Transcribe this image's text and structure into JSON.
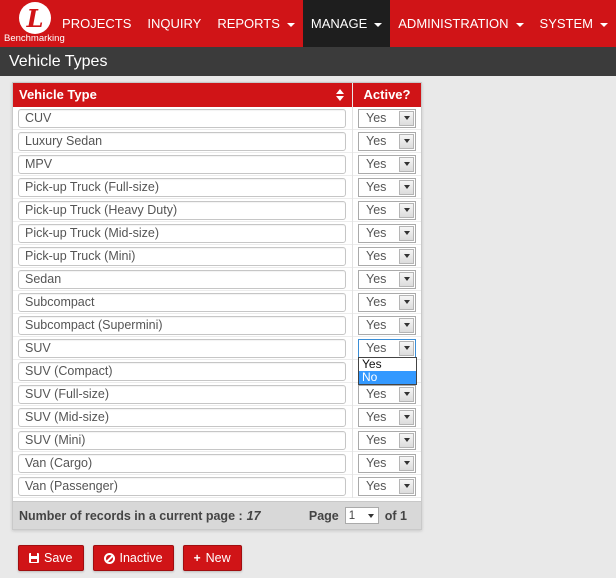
{
  "brand": {
    "name": "Benchmarking",
    "logo_letter": "L"
  },
  "nav": {
    "items": [
      {
        "label": "PROJECTS",
        "has_caret": false,
        "active": false
      },
      {
        "label": "INQUIRY",
        "has_caret": false,
        "active": false
      },
      {
        "label": "REPORTS",
        "has_caret": true,
        "active": false
      },
      {
        "label": "MANAGE",
        "has_caret": true,
        "active": true
      },
      {
        "label": "ADMINISTRATION",
        "has_caret": true,
        "active": false
      },
      {
        "label": "SYSTEM",
        "has_caret": true,
        "active": false
      }
    ]
  },
  "page": {
    "title": "Vehicle Types"
  },
  "table": {
    "columns": {
      "type": "Vehicle Type",
      "active": "Active?"
    },
    "rows": [
      {
        "type": "CUV",
        "active": "Yes"
      },
      {
        "type": "Luxury Sedan",
        "active": "Yes"
      },
      {
        "type": "MPV",
        "active": "Yes"
      },
      {
        "type": "Pick-up Truck (Full-size)",
        "active": "Yes"
      },
      {
        "type": "Pick-up Truck (Heavy Duty)",
        "active": "Yes"
      },
      {
        "type": "Pick-up Truck (Mid-size)",
        "active": "Yes"
      },
      {
        "type": "Pick-up Truck (Mini)",
        "active": "Yes"
      },
      {
        "type": "Sedan",
        "active": "Yes"
      },
      {
        "type": "Subcompact",
        "active": "Yes"
      },
      {
        "type": "Subcompact (Supermini)",
        "active": "Yes"
      },
      {
        "type": "SUV",
        "active": "Yes"
      },
      {
        "type": "SUV (Compact)",
        "active": "Yes"
      },
      {
        "type": "SUV (Full-size)",
        "active": "Yes"
      },
      {
        "type": "SUV (Mid-size)",
        "active": "Yes"
      },
      {
        "type": "SUV (Mini)",
        "active": "Yes"
      },
      {
        "type": "Van (Cargo)",
        "active": "Yes"
      },
      {
        "type": "Van (Passenger)",
        "active": "Yes"
      }
    ],
    "open_dropdown": {
      "row_index": 10,
      "options": [
        "Yes",
        "No"
      ],
      "highlighted": "No"
    }
  },
  "footer": {
    "records_label": "Number of records in a current page :",
    "records_count": "17",
    "page_label": "Page",
    "page_value": "1",
    "of_label": "of 1"
  },
  "actions": {
    "save": "Save",
    "inactive": "Inactive",
    "new": "New"
  },
  "colors": {
    "brand_red": "#d01417",
    "active_nav_bg": "#1e1e1e",
    "title_bar_bg": "#3b3b3b"
  }
}
